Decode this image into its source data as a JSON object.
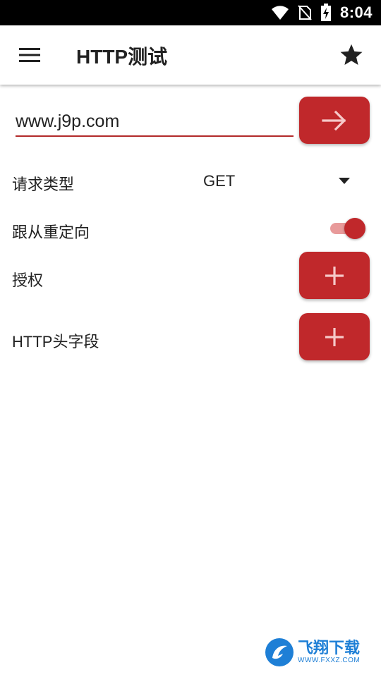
{
  "status_bar": {
    "time": "8:04"
  },
  "toolbar": {
    "title": "HTTP测试"
  },
  "url": {
    "value": "www.j9p.com"
  },
  "request_type": {
    "label": "请求类型",
    "selected": "GET"
  },
  "follow_redirect": {
    "label": "跟从重定向",
    "enabled": true
  },
  "authorization": {
    "label": "授权"
  },
  "http_headers": {
    "label": "HTTP头字段"
  },
  "watermark": {
    "name": "飞翔下载",
    "url": "WWW.FXXZ.COM"
  },
  "colors": {
    "accent": "#c0282b",
    "toggle_track": "#e89a9a",
    "watermark": "#1e7fd6"
  },
  "icons": [
    "wifi-icon",
    "no-sim-icon",
    "battery-charging-icon",
    "menu-icon",
    "star-icon",
    "arrow-right-icon",
    "dropdown-arrow-icon",
    "plus-icon"
  ]
}
